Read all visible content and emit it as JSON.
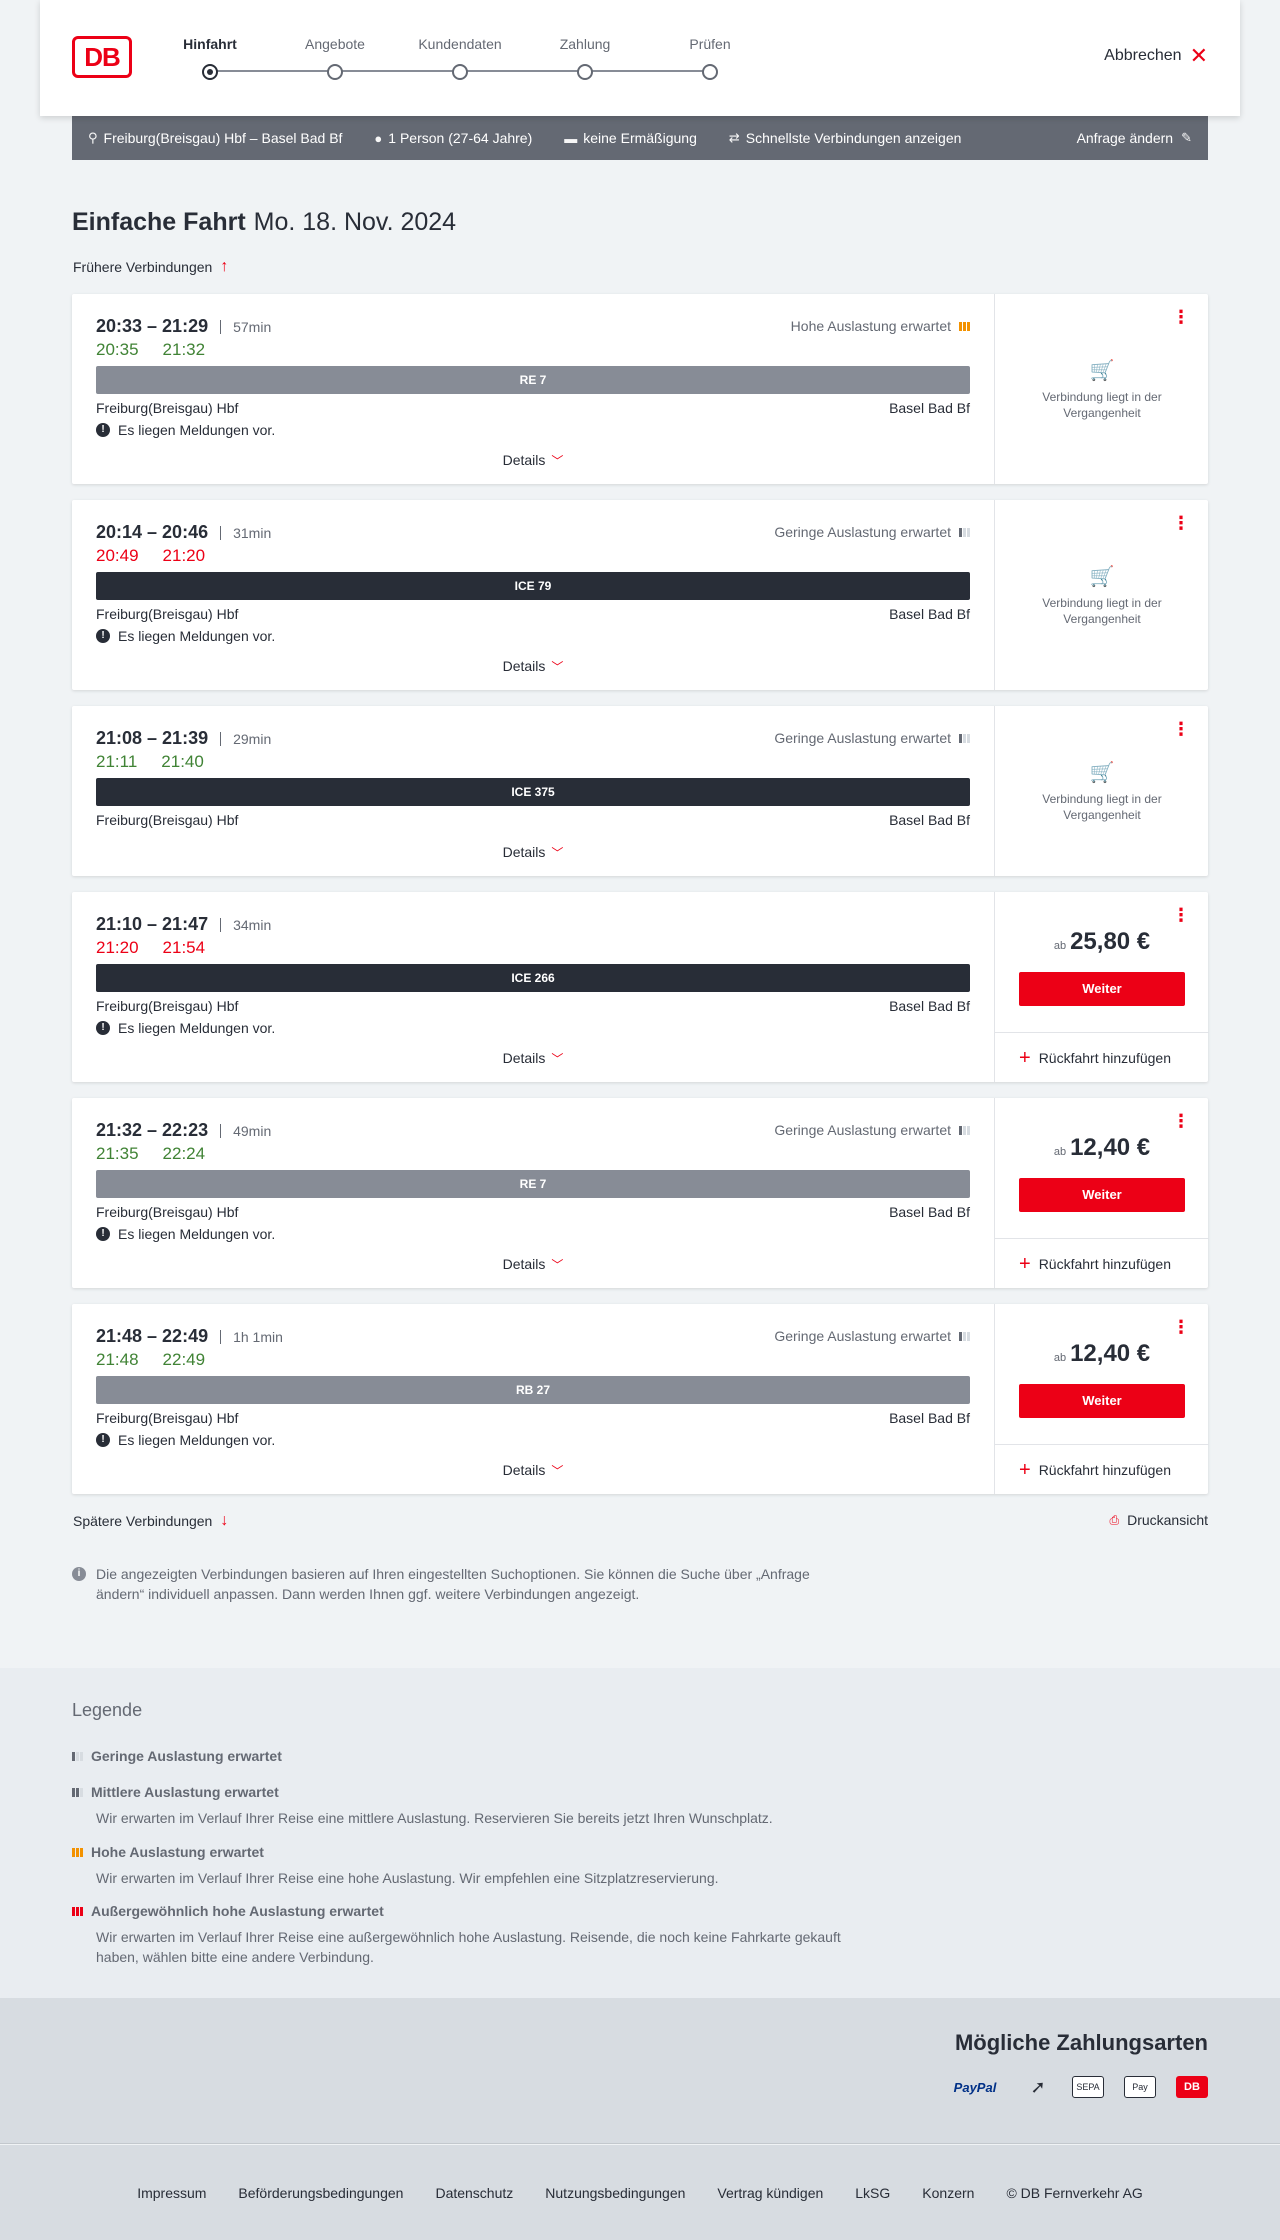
{
  "header": {
    "logo": "DB",
    "steps": [
      "Hinfahrt",
      "Angebote",
      "Kundendaten",
      "Zahlung",
      "Prüfen"
    ],
    "active_step": "Hinfahrt",
    "cancel_label": "Abbrechen"
  },
  "search": {
    "route": "Freiburg(Breisgau) Hbf – Basel Bad Bf",
    "passengers": "1 Person (27-64 Jahre)",
    "discount": "keine Ermäßigung",
    "fastest": "Schnellste Verbindungen anzeigen",
    "edit": "Anfrage ändern"
  },
  "title": {
    "trip_type": "Einfache Fahrt",
    "date": "Mo. 18. Nov. 2024"
  },
  "earlier_label": "Frühere Verbindungen",
  "later_label": "Spätere Verbindungen",
  "print_label": "Druckansicht",
  "details_label": "Details",
  "past_label": "Verbindung liegt in der Vergangenheit",
  "price_prefix": "ab",
  "weiter_label": "Weiter",
  "return_label": "Rückfahrt hinzufügen",
  "connections": [
    {
      "times": "20:33 – 21:29",
      "duration": "57min",
      "rt_dep": "20:35",
      "rt_arr": "21:32",
      "rt_status": "green",
      "load": "Hohe Auslastung erwartet",
      "load_level": "high",
      "train": "RE 7",
      "train_type": "regio",
      "from": "Freiburg(Breisgau) Hbf",
      "to": "Basel Bad Bf",
      "message": "Es liegen Meldungen vor.",
      "past": true
    },
    {
      "times": "20:14 – 20:46",
      "duration": "31min",
      "rt_dep": "20:49",
      "rt_arr": "21:20",
      "rt_status": "red",
      "load": "Geringe Auslastung erwartet",
      "load_level": "low",
      "train": "ICE 79",
      "train_type": "ice",
      "from": "Freiburg(Breisgau) Hbf",
      "to": "Basel Bad Bf",
      "message": "Es liegen Meldungen vor.",
      "past": true
    },
    {
      "times": "21:08 – 21:39",
      "duration": "29min",
      "rt_dep": "21:11",
      "rt_arr": "21:40",
      "rt_status": "green",
      "load": "Geringe Auslastung erwartet",
      "load_level": "low",
      "train": "ICE 375",
      "train_type": "ice",
      "from": "Freiburg(Breisgau) Hbf",
      "to": "Basel Bad Bf",
      "message": "",
      "past": true
    },
    {
      "times": "21:10 – 21:47",
      "duration": "34min",
      "rt_dep": "21:20",
      "rt_arr": "21:54",
      "rt_status": "red",
      "load": "",
      "load_level": "",
      "train": "ICE 266",
      "train_type": "ice",
      "from": "Freiburg(Breisgau) Hbf",
      "to": "Basel Bad Bf",
      "message": "Es liegen Meldungen vor.",
      "past": false,
      "price": "25,80 €"
    },
    {
      "times": "21:32 – 22:23",
      "duration": "49min",
      "rt_dep": "21:35",
      "rt_arr": "22:24",
      "rt_status": "green",
      "load": "Geringe Auslastung erwartet",
      "load_level": "low",
      "train": "RE 7",
      "train_type": "regio",
      "from": "Freiburg(Breisgau) Hbf",
      "to": "Basel Bad Bf",
      "message": "Es liegen Meldungen vor.",
      "past": false,
      "price": "12,40 €"
    },
    {
      "times": "21:48 – 22:49",
      "duration": "1h 1min",
      "rt_dep": "21:48",
      "rt_arr": "22:49",
      "rt_status": "green",
      "load": "Geringe Auslastung erwartet",
      "load_level": "low",
      "train": "RB 27",
      "train_type": "regio",
      "from": "Freiburg(Breisgau) Hbf",
      "to": "Basel Bad Bf",
      "message": "Es liegen Meldungen vor.",
      "past": false,
      "price": "12,40 €"
    }
  ],
  "info_text": "Die angezeigten Verbindungen basieren auf Ihren eingestellten Suchoptionen. Sie können die Suche über „Anfrage ändern“ individuell anpassen. Dann werden Ihnen ggf. weitere Verbindungen angezeigt.",
  "legend": {
    "title": "Legende",
    "items": [
      {
        "title": "Geringe Auslastung erwartet",
        "desc": ""
      },
      {
        "title": "Mittlere Auslastung erwartet",
        "desc": "Wir erwarten im Verlauf Ihrer Reise eine mittlere Auslastung. Reservieren Sie bereits jetzt Ihren Wunschplatz."
      },
      {
        "title": "Hohe Auslastung erwartet",
        "desc": "Wir erwarten im Verlauf Ihrer Reise eine hohe Auslastung. Wir empfehlen eine Sitzplatzreservierung."
      },
      {
        "title": "Außergewöhnlich hohe Auslastung erwartet",
        "desc": "Wir erwarten im Verlauf Ihrer Reise eine außergewöhnlich hohe Auslastung. Reisende, die noch keine Fahrkarte gekauft haben, wählen bitte eine andere Verbindung."
      }
    ]
  },
  "payment": {
    "title": "Mögliche Zahlungsarten",
    "methods": [
      "PayPal",
      "kontaktlos",
      "SEPA",
      "Pay",
      "DB"
    ]
  },
  "footer": [
    "Impressum",
    "Beförderungsbedingungen",
    "Datenschutz",
    "Nutzungsbedingungen",
    "Vertrag kündigen",
    "LkSG",
    "Konzern",
    "© DB Fernverkehr AG"
  ]
}
